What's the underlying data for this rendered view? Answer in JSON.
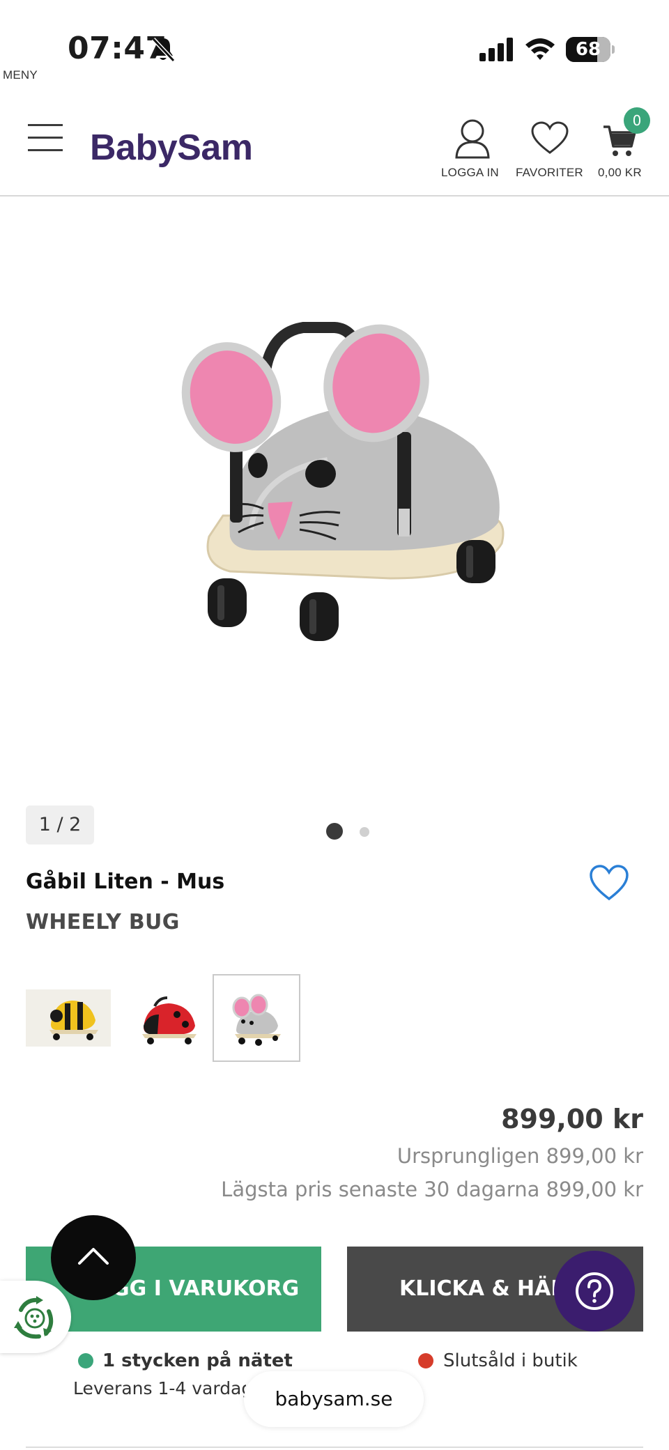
{
  "status_bar": {
    "time": "07:47",
    "battery_level": "68",
    "icons": [
      "bell-slash-icon",
      "signal-icon",
      "wifi-icon",
      "battery-icon"
    ]
  },
  "header": {
    "menu_label": "MENY",
    "logo": "BabySam",
    "login_label": "LOGGA IN",
    "favorites_label": "FAVORITER",
    "cart_total": "0,00 KR",
    "cart_count": "0"
  },
  "gallery": {
    "counter": "1 / 2",
    "image_count": 2,
    "active_index": 0
  },
  "product": {
    "title": "Gåbil Liten - Mus",
    "brand": "WHEELY BUG",
    "variants": [
      "bee",
      "ladybug",
      "mouse"
    ],
    "selected_variant": "mouse",
    "price": "899,00 kr",
    "original_price": "Ursprungligen 899,00 kr",
    "lowest_price": "Lägsta pris senaste 30 dagarna 899,00 kr"
  },
  "actions": {
    "add_to_cart": "LÄGG I VARUKORG",
    "click_and_collect": "KLICKA & HÄMTA"
  },
  "stock": {
    "online_text": "1 stycken på nätet",
    "online_color": "#3aa57a",
    "store_text": "Slutsåld i butik",
    "store_color": "#d63c2a",
    "delivery_text": "Leverans 1-4 vardagar"
  },
  "browser": {
    "url": "babysam.se"
  },
  "colors": {
    "brand": "#3b2866",
    "accent_green": "#3ea674",
    "dark_button": "#494949",
    "help_purple": "#3b1d6e"
  }
}
